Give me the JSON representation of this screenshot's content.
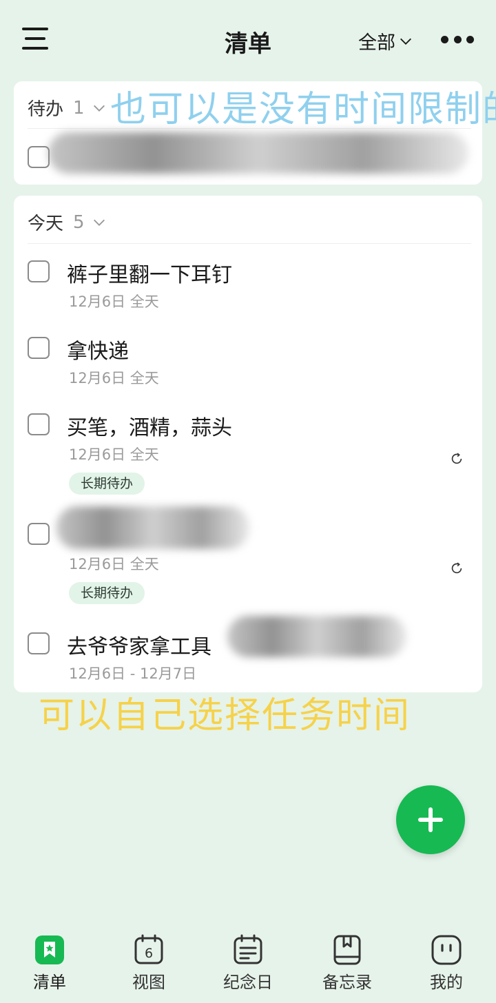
{
  "header": {
    "title": "清单",
    "filter_label": "全部"
  },
  "todo_section": {
    "label": "待办",
    "count": "1"
  },
  "today_section": {
    "label": "今天",
    "count": "5",
    "tasks": [
      {
        "title": "裤子里翻一下耳钉",
        "date": "12月6日 全天"
      },
      {
        "title": "拿快递",
        "date": "12月6日 全天"
      },
      {
        "title": "买笔，酒精，蒜头",
        "date": "12月6日 全天",
        "tag": "长期待办"
      },
      {
        "title": "",
        "date": "12月6日 全天",
        "tag": "长期待办"
      },
      {
        "title": "去爷爷家拿工具",
        "date": "12月6日 - 12月7日"
      }
    ]
  },
  "annotations": {
    "blue_note": "也可以是没有时间限制的",
    "yellow_note": "可以自己选择任务时间"
  },
  "bottom_nav": [
    {
      "label": "清单",
      "icon": "checklist-icon",
      "active": true
    },
    {
      "label": "视图",
      "icon": "calendar-view-icon",
      "badge": "6"
    },
    {
      "label": "纪念日",
      "icon": "anniversary-icon"
    },
    {
      "label": "备忘录",
      "icon": "memo-icon"
    },
    {
      "label": "我的",
      "icon": "profile-icon"
    }
  ],
  "colors": {
    "accent": "#17b953",
    "background": "#e6f3ea",
    "tag_bg": "#e1f4e7",
    "blue_note": "#8fd0ee",
    "yellow_note": "#f6d24a"
  }
}
